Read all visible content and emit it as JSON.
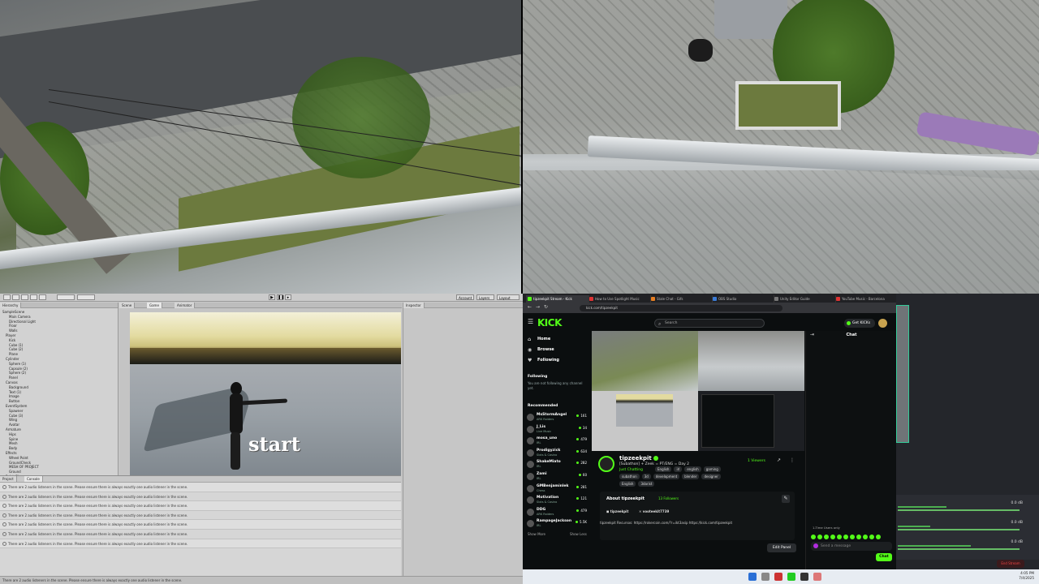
{
  "unity": {
    "tabs": {
      "hierarchy": "Hierarchy",
      "scene": "Scene",
      "game": "Game",
      "animator": "Animator",
      "inspector": "Inspector",
      "project": "Project",
      "console": "Console"
    },
    "toolbar": {
      "account": "Account",
      "layers": "Layers",
      "layout": "Layout"
    },
    "hierarchy_items": [
      "SampleScene",
      "Main Camera",
      "Directional Light",
      "Floor",
      "Walls",
      "Player",
      "Kick",
      "Cube (1)",
      "Cube (2)",
      "Plane",
      "Cylinder",
      "Sphere (1)",
      "Capsule (2)",
      "Sphere (2)",
      "Panel",
      "Canvas",
      "Background",
      "Text (1)",
      "Image",
      "Button",
      "EventSystem",
      "Spawner",
      "Cube (3)",
      "Wing",
      "Avatar",
      "Armature",
      "Hips",
      "Spine",
      "Mesh",
      "Body",
      "Effects",
      "Wheel Point",
      "GroundCheck",
      "MESH OF PROJECT",
      "Ground",
      "Point (1)",
      "Point (2)",
      "Rig",
      "Cube (4)",
      "Wing (1)",
      "Chain"
    ],
    "scene_text": "start",
    "console_message": "There are 2 audio listeners in the scene. Please ensure there is always exactly one audio listener in the scene.",
    "console_rows": 7,
    "status_text": "There are 2 audio listeners in the scene. Please ensure there is always exactly one audio listener in the scene."
  },
  "browser": {
    "tabs": [
      {
        "label": "tipzeekpit Stream - Kick",
        "color": "#53fc18",
        "active": true
      },
      {
        "label": "How to Use Spotlight Music",
        "color": "#d33",
        "active": false
      },
      {
        "label": "Stale Chat - Gifs",
        "color": "#e67e22",
        "active": false
      },
      {
        "label": "OBS Studio",
        "color": "#3a7bd5",
        "active": false
      },
      {
        "label": "Unity Editor Guide",
        "color": "#777",
        "active": false
      },
      {
        "label": "YouTube Music - Barcelona",
        "color": "#d33",
        "active": false
      }
    ],
    "url": "kick.com/tipzeekpit"
  },
  "kick": {
    "logo": "KICK",
    "search_placeholder": "Search",
    "get_kicks": "Get KICKs",
    "nav": [
      {
        "label": "Home",
        "icon": "home-icon",
        "glyph": "⌂"
      },
      {
        "label": "Browse",
        "icon": "compass-icon",
        "glyph": "◉"
      },
      {
        "label": "Following",
        "icon": "heart-icon",
        "glyph": "♥"
      }
    ],
    "following_title": "Following",
    "following_note": "You are not following any channel yet.",
    "recommended_title": "Recommended",
    "recommended": [
      {
        "name": "MsStormAngel",
        "category": "ARK Raiders",
        "viewers": "161"
      },
      {
        "name": "J_Lis",
        "category": "Live Music",
        "viewers": "34"
      },
      {
        "name": "mosa_uno",
        "category": "IRL",
        "viewers": "479"
      },
      {
        "name": "Prodigyzick",
        "category": "Slots & Casino",
        "viewers": "634"
      },
      {
        "name": "ShakeMiato",
        "category": "IRL",
        "viewers": "282"
      },
      {
        "name": "Zami",
        "category": "IRL",
        "viewers": "60"
      },
      {
        "name": "GMBenjaminlek",
        "category": "Chess",
        "viewers": "281"
      },
      {
        "name": "Motivation",
        "category": "Slots & Casino",
        "viewers": "121"
      },
      {
        "name": "DDG",
        "category": "ARK Raiders",
        "viewers": "479"
      },
      {
        "name": "RampageJackson",
        "category": "IRL",
        "viewers": "5.5K"
      }
    ],
    "show_more": "Show More",
    "show_less": "Show Less",
    "channel": {
      "name": "tipzeekpit",
      "title": "[Subathon] + Zeek = PT/ENG = Day 2",
      "category": "Just Chatting",
      "tags_row1": [
        "English",
        "irl",
        "english",
        "gaming"
      ],
      "tags_row2": [
        "subathon",
        "3d",
        "development",
        "blender",
        "designer"
      ],
      "tags_row3": [
        "English",
        "3darist"
      ],
      "viewers": "1 Viewers"
    },
    "about": {
      "title": "About tipzeekpit",
      "followers": "13 Followers",
      "socials": [
        "tipzeekpit",
        "vooteekit7739"
      ],
      "links": "tipzeekpit  Recursos: https://rokercoin.com/?r=ikt3asip  https://kick.com/tipzeekpit",
      "edit_panel": "Edit Panel"
    },
    "chat": {
      "title": "Chat",
      "slow_mode": "1-Time Users only",
      "placeholder": "Send a message",
      "send": "Chat"
    }
  },
  "obs": {
    "db_values": [
      "0.0 dB",
      "0.0 dB",
      "0.0 dB"
    ],
    "record_label": "End Stream"
  },
  "taskbar": {
    "time": "4:05 PM",
    "date": "7/4/2025"
  }
}
